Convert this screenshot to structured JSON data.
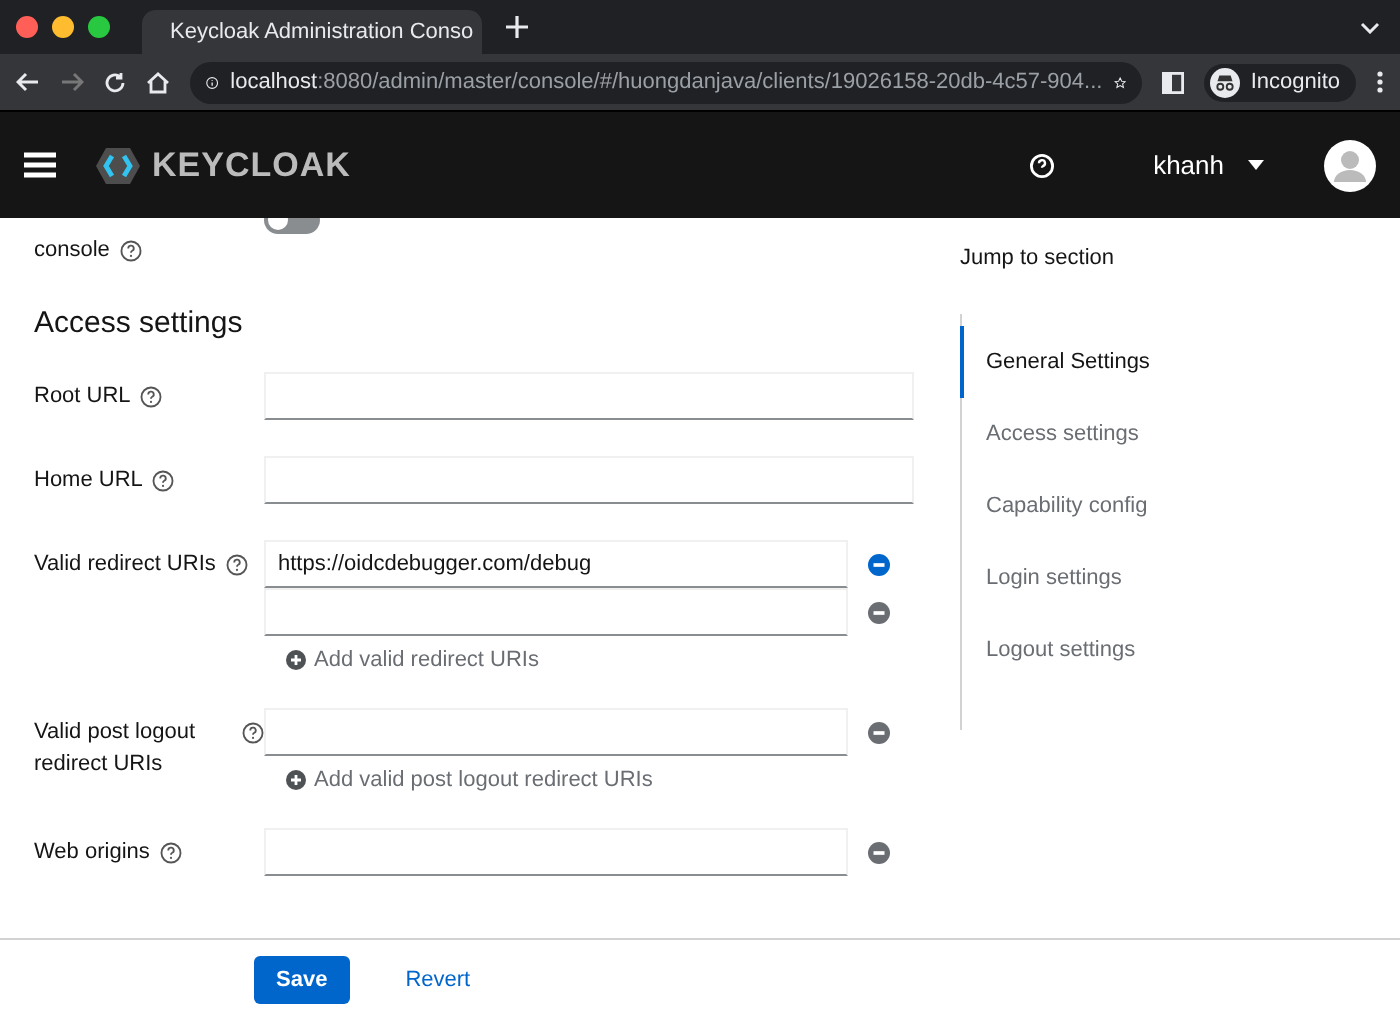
{
  "browser": {
    "tab_title": "Keycloak Administration Conso",
    "url_host": "localhost",
    "url_path": ":8080/admin/master/console/#/huongdanjava/clients/19026158-20db-4c57-904...",
    "profile": "Incognito"
  },
  "header": {
    "brand": "KEYCLOAK",
    "user": "khanh"
  },
  "toggle": {
    "label": "console",
    "on": false
  },
  "section_title": "Access settings",
  "fields": [
    {
      "kind": "single",
      "label": "Root URL"
    },
    {
      "kind": "single",
      "label": "Home URL"
    },
    {
      "kind": "multi",
      "label": "Valid redirect URIs",
      "values": [
        {
          "value": "https://oidcdebugger.com/debug",
          "removable": true
        },
        {
          "removable": false
        }
      ],
      "add_label": "Add valid redirect URIs"
    },
    {
      "kind": "multi",
      "label": "Valid post logout redirect URIs",
      "values": [
        {
          "removable": false
        }
      ],
      "add_label": "Add valid post logout redirect URIs"
    },
    {
      "kind": "multi",
      "label": "Web origins",
      "values": [
        {
          "removable": false
        }
      ]
    }
  ],
  "jump": {
    "title": "Jump to section",
    "items": [
      {
        "label": "General Settings",
        "selected": true
      },
      {
        "label": "Access settings",
        "selected": false
      },
      {
        "label": "Capability config",
        "selected": false
      },
      {
        "label": "Login settings",
        "selected": false
      },
      {
        "label": "Logout settings",
        "selected": false
      }
    ]
  },
  "footer": {
    "save": "Save",
    "revert": "Revert"
  }
}
